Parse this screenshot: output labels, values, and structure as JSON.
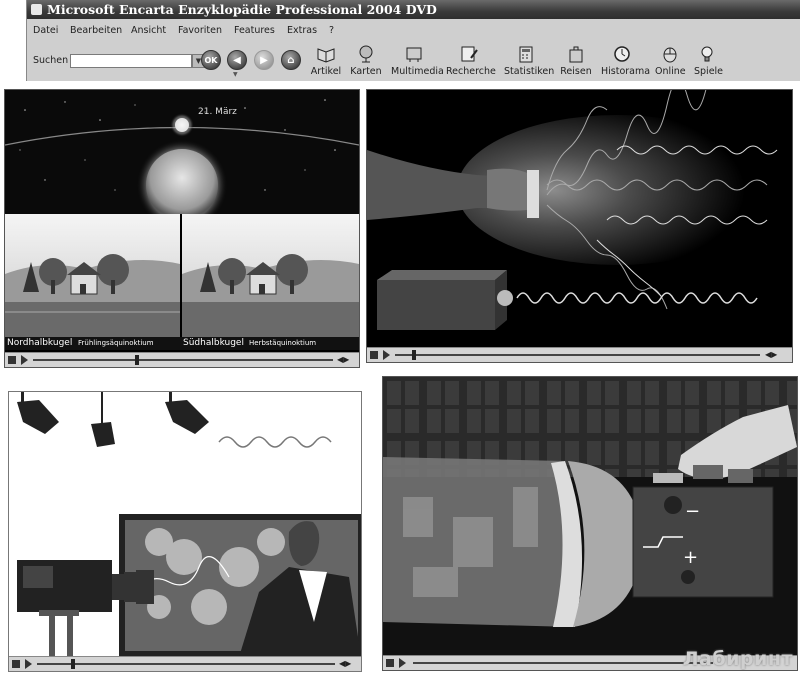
{
  "window": {
    "title": "Microsoft Encarta Enzyklopädie Professional 2004 DVD"
  },
  "menu": [
    "Datei",
    "Bearbeiten",
    "Ansicht",
    "Favoriten",
    "Features",
    "Extras",
    "?"
  ],
  "search": {
    "label": "Suchen",
    "value": "",
    "ok_label": "OK"
  },
  "toolbar": [
    {
      "label": "Artikel",
      "icon": "book-icon"
    },
    {
      "label": "Karten",
      "icon": "globe-icon"
    },
    {
      "label": "Multimedia",
      "icon": "multimedia-icon"
    },
    {
      "label": "Recherche",
      "icon": "research-icon"
    },
    {
      "label": "Statistiken",
      "icon": "calculator-icon"
    },
    {
      "label": "Reisen",
      "icon": "suitcase-icon"
    },
    {
      "label": "Historama",
      "icon": "clock-icon"
    },
    {
      "label": "Online",
      "icon": "mouse-icon"
    },
    {
      "label": "Spiele",
      "icon": "lightbulb-icon"
    }
  ],
  "panels": {
    "equinox": {
      "date_label": "21. März",
      "captions": [
        {
          "bold": "Nordhalbkugel",
          "small": "Frühlingsäquinoktium"
        },
        {
          "bold": "Südhalbkugel",
          "small": "Herbstäquinoktium"
        }
      ]
    }
  },
  "watermark": "Лабиринт",
  "colors": {
    "titlebar": "#3a3a3a",
    "menubar": "#cfcfcf",
    "panel_dark": "#111111"
  }
}
